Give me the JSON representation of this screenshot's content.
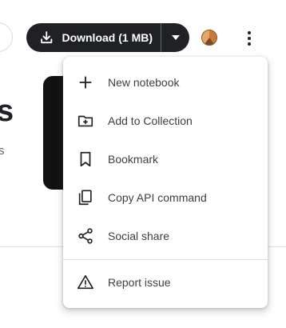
{
  "download": {
    "label": "Download (1 MB)"
  },
  "background": {
    "big_text": "s",
    "small_text": "s"
  },
  "menu": {
    "items": [
      {
        "label": "New notebook",
        "icon": "plus-icon"
      },
      {
        "label": "Add to Collection",
        "icon": "folder-add-icon"
      },
      {
        "label": "Bookmark",
        "icon": "bookmark-icon"
      },
      {
        "label": "Copy API command",
        "icon": "copy-icon"
      },
      {
        "label": "Social share",
        "icon": "share-icon"
      },
      {
        "label": "Report issue",
        "icon": "warning-icon"
      }
    ]
  },
  "colors": {
    "button_bg": "#202124",
    "button_text": "#ffffff",
    "menu_text": "#3c4043",
    "divider": "#e0e0e0"
  }
}
